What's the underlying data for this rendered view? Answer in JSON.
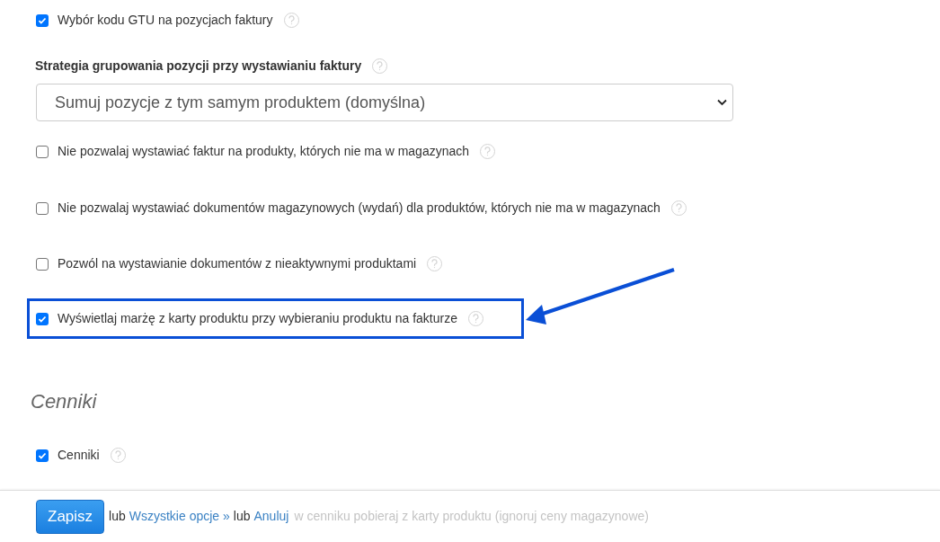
{
  "settings": [
    {
      "kind": "checkbox",
      "label": "Wybór kodu GTU na pozycjach faktury",
      "checked": true,
      "highlighted": false
    },
    {
      "kind": "select",
      "label": "Strategia grupowania pozycji przy wystawianiu faktury",
      "value": "Sumuj pozycje z tym samym produktem (domyślna)"
    },
    {
      "kind": "checkbox",
      "label": "Nie pozwalaj wystawiać faktur na produkty, których nie ma w magazynach",
      "checked": false,
      "highlighted": false
    },
    {
      "kind": "checkbox",
      "label": "Nie pozwalaj wystawiać dokumentów magazynowych (wydań) dla produktów, których nie ma w magazynach",
      "checked": false,
      "highlighted": false
    },
    {
      "kind": "checkbox",
      "label": "Pozwól na wystawianie dokumentów z nieaktywnymi produktami",
      "checked": false,
      "highlighted": false
    },
    {
      "kind": "checkbox",
      "label": "Wyświetlaj marżę z karty produktu przy wybieraniu produktu na fakturze",
      "checked": true,
      "highlighted": true
    },
    {
      "kind": "heading",
      "label": "Cenniki"
    },
    {
      "kind": "checkbox",
      "label": "Cenniki",
      "checked": true,
      "highlighted": false
    }
  ],
  "footer": {
    "save": "Zapisz",
    "or_1": "lub",
    "all_options": "Wszystkie opcje »",
    "or_2": "lub",
    "cancel": "Anuluj",
    "hidden_row_text": "w cenniku pobieraj z karty produktu (ignoruj ceny magazynowe)"
  }
}
